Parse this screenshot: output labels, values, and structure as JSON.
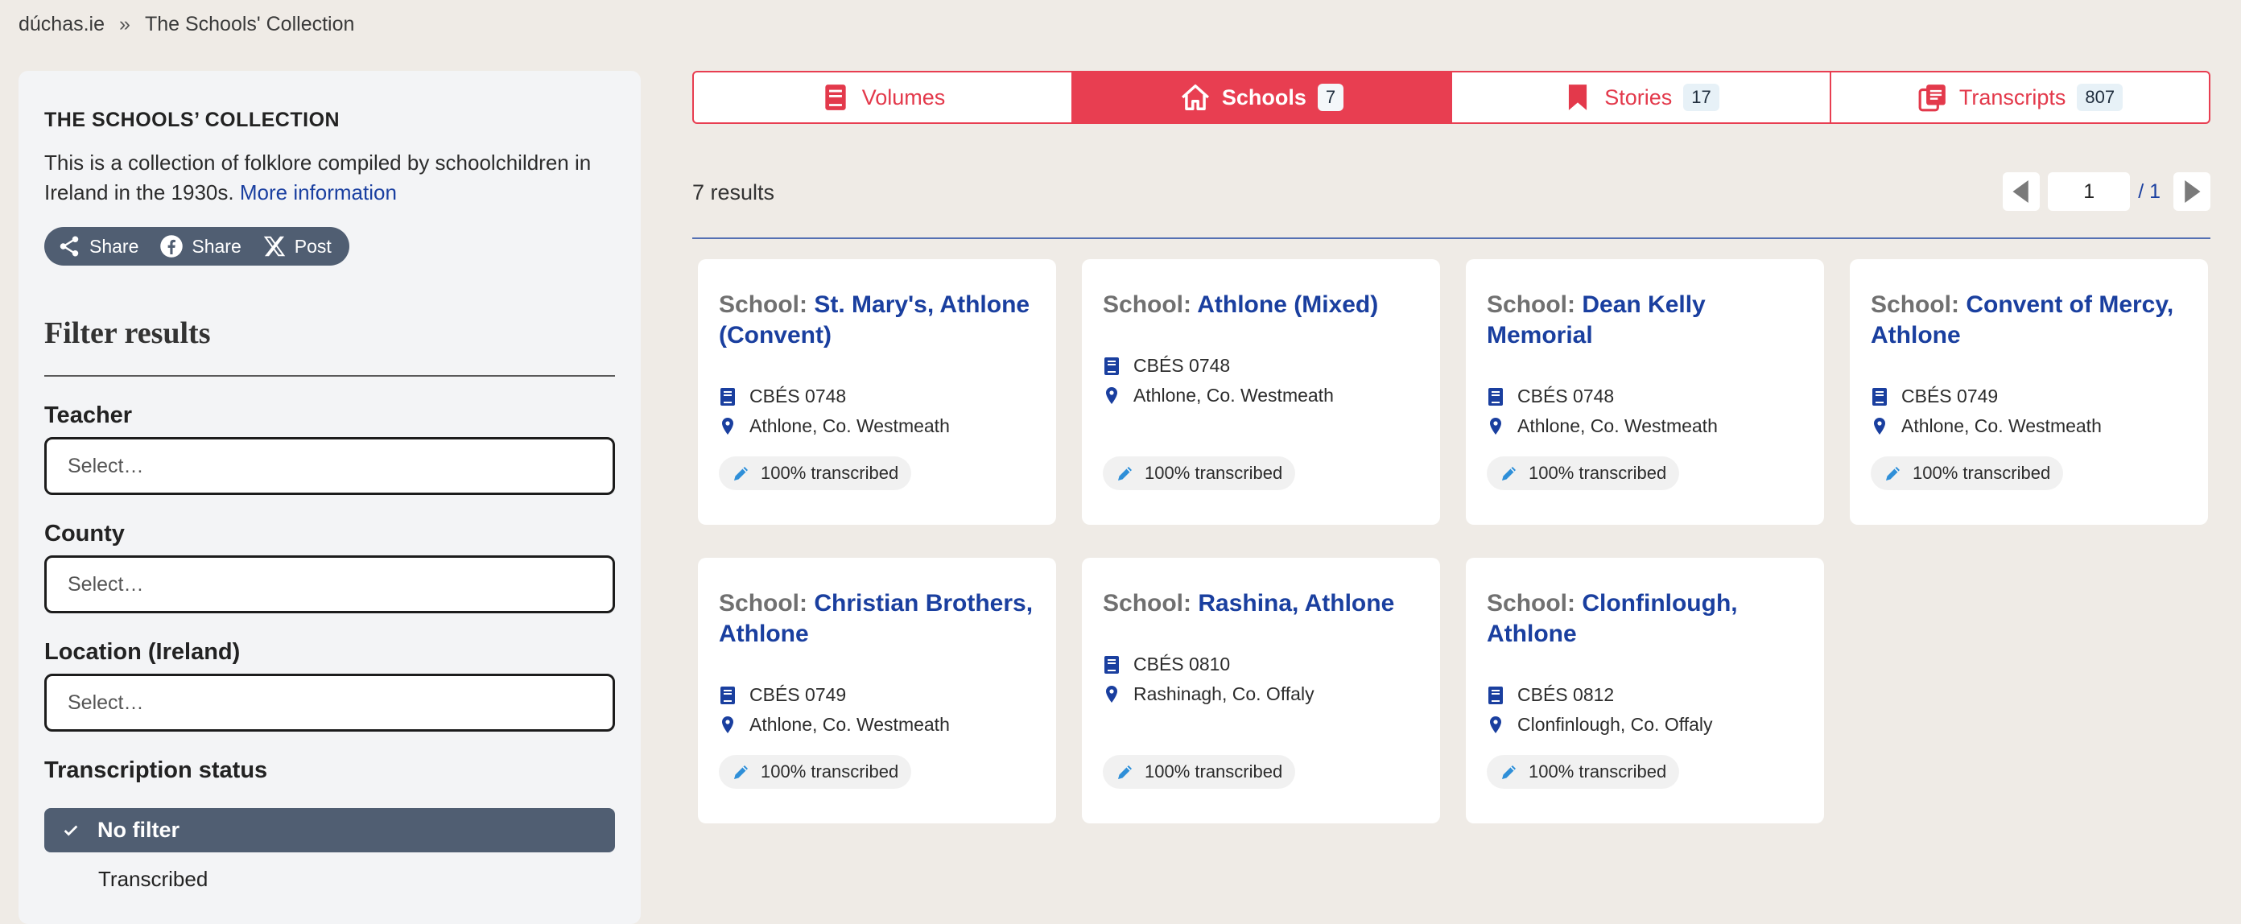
{
  "breadcrumb": {
    "site": "dúchas.ie",
    "separator": "»",
    "page": "The Schools' Collection"
  },
  "sidebar": {
    "heading": "THE SCHOOLS’ COLLECTION",
    "description": "This is a collection of folklore compiled by schoolchildren in Ireland in the 1930s.",
    "more_link": "More information",
    "share": [
      {
        "label": "Share",
        "icon": "share-icon"
      },
      {
        "label": "Share",
        "icon": "facebook-icon"
      },
      {
        "label": "Post",
        "icon": "x-icon"
      }
    ],
    "filter_title": "Filter results",
    "fields": [
      {
        "label": "Teacher",
        "placeholder": "Select…"
      },
      {
        "label": "County",
        "placeholder": "Select…"
      },
      {
        "label": "Location (Ireland)",
        "placeholder": "Select…"
      }
    ],
    "status_label": "Transcription status",
    "status_selected": "No filter",
    "status_option": "Transcribed"
  },
  "tabs": [
    {
      "label": "Volumes",
      "icon": "book-icon",
      "count": ""
    },
    {
      "label": "Schools",
      "icon": "home-icon",
      "count": "7"
    },
    {
      "label": "Stories",
      "icon": "bookmark-icon",
      "count": "17"
    },
    {
      "label": "Transcripts",
      "icon": "transcript-icon",
      "count": "807"
    }
  ],
  "results": {
    "count_text": "7 results",
    "page": "1",
    "total_pages": "/ 1"
  },
  "card_prefix": "School:",
  "cards": [
    {
      "name": "St. Mary's, Athlone (Convent)",
      "volume": "CBÉS 0748",
      "location": "Athlone, Co. Westmeath",
      "status": "100% transcribed"
    },
    {
      "name": "Athlone (Mixed)",
      "volume": "CBÉS 0748",
      "location": "Athlone, Co. Westmeath",
      "status": "100% transcribed"
    },
    {
      "name": "Dean Kelly Memorial",
      "volume": "CBÉS 0748",
      "location": "Athlone, Co. Westmeath",
      "status": "100% transcribed"
    },
    {
      "name": "Convent of Mercy, Athlone",
      "volume": "CBÉS 0749",
      "location": "Athlone, Co. Westmeath",
      "status": "100% transcribed"
    },
    {
      "name": "Christian Brothers, Athlone",
      "volume": "CBÉS 0749",
      "location": "Athlone, Co. Westmeath",
      "status": "100% transcribed"
    },
    {
      "name": "Rashina, Athlone",
      "volume": "CBÉS 0810",
      "location": "Rashinagh, Co. Offaly",
      "status": "100% transcribed"
    },
    {
      "name": "Clonfinlough, Athlone",
      "volume": "CBÉS 0812",
      "location": "Clonfinlough, Co. Offaly",
      "status": "100% transcribed"
    }
  ],
  "colors": {
    "accent": "#e83e51",
    "link": "#1a3f9f",
    "slate": "#505e72",
    "background": "#efebe6"
  }
}
